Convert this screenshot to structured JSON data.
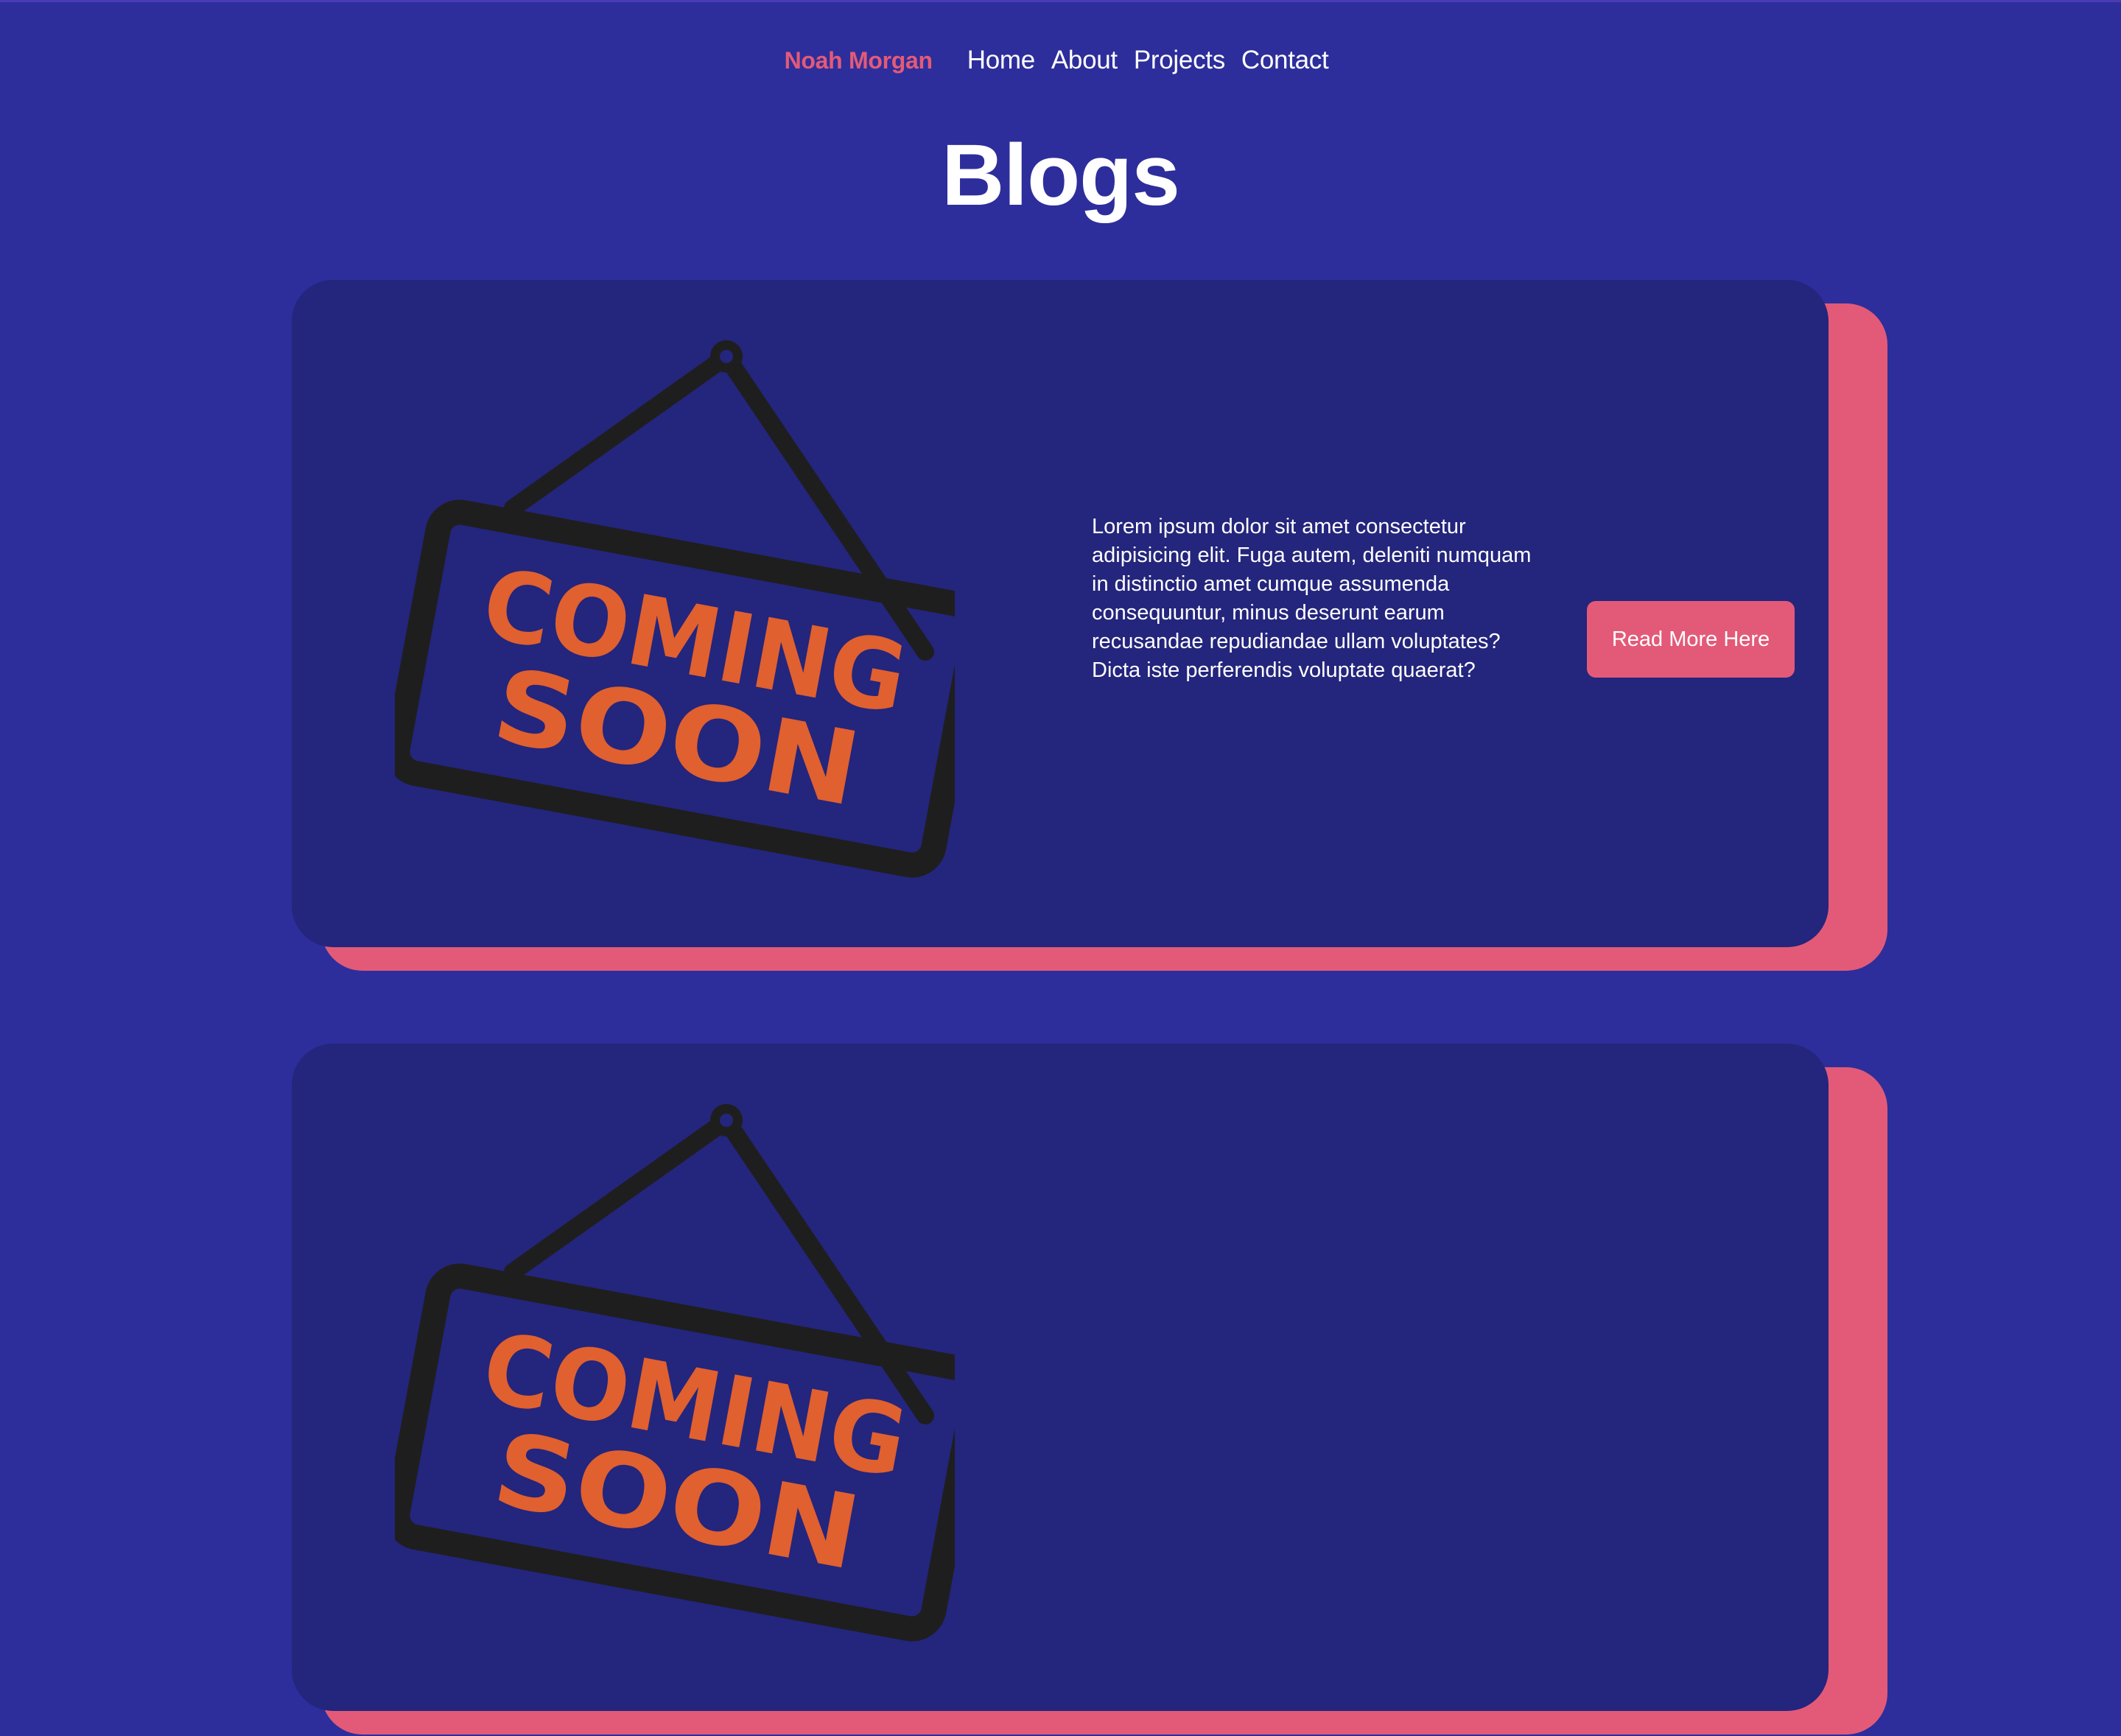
{
  "nav": {
    "brand": "Noah Morgan",
    "links": [
      "Home",
      "About",
      "Projects",
      "Contact"
    ]
  },
  "page_title": "Blogs",
  "posts": [
    {
      "image_text_line1": "COMING",
      "image_text_line2": "SOON",
      "excerpt": "Lorem ipsum dolor sit amet consectetur adipisicing elit. Fuga autem, deleniti numquam in distinctio amet cumque assumenda consequuntur, minus deserunt earum recusandae repudiandae ullam voluptates? Dicta iste perferendis voluptate quaerat?",
      "button_label": "Read More Here"
    },
    {
      "image_text_line1": "COMING",
      "image_text_line2": "SOON"
    }
  ],
  "colors": {
    "background": "#2d2e9b",
    "card": "#24257c",
    "accent": "#e35a78",
    "sign_text": "#e0602f",
    "sign_frame": "#1e1e1e"
  }
}
